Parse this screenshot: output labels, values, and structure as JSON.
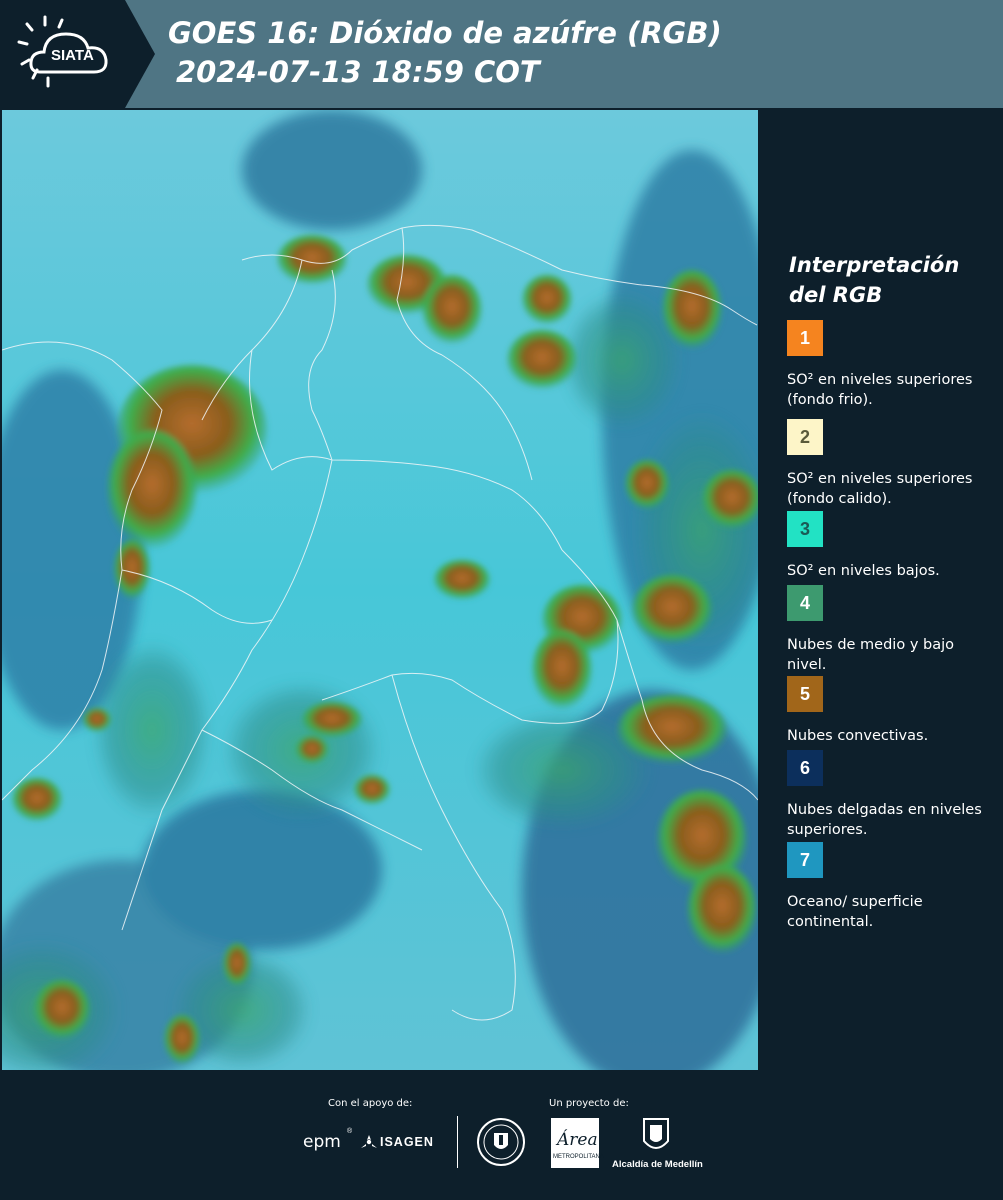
{
  "header": {
    "logo_text": "SIATA",
    "title_line1": "GOES 16: Dióxido de azúfre (RGB)",
    "title_line2": "2024-07-13 18:59 COT"
  },
  "legend": {
    "title": "Interpretación del RGB",
    "items": [
      {
        "number": "1",
        "color": "#f5841f",
        "description": "SO² en niveles superiores (fondo frio)."
      },
      {
        "number": "2",
        "color": "#fdf5c8",
        "description": "SO² en niveles superiores (fondo calido)."
      },
      {
        "number": "3",
        "color": "#22e2c4",
        "description": "SO² en niveles bajos."
      },
      {
        "number": "4",
        "color": "#3d9a6f",
        "description": "Nubes de medio y bajo nivel."
      },
      {
        "number": "5",
        "color": "#a1661a",
        "description": "Nubes convectivas."
      },
      {
        "number": "6",
        "color": "#0c2f5c",
        "description": "Nubes delgadas en niveles superiores."
      },
      {
        "number": "7",
        "color": "#1f97c0",
        "description": "Oceano/ superficie continental."
      }
    ]
  },
  "footer": {
    "support_label": "Con el apoyo de:",
    "project_label": "Un proyecto de:",
    "sponsor_epm": "epm",
    "sponsor_isagen": "ISAGEN",
    "area_logo_text": "Área",
    "area_subtitle": "METROPOLITANA",
    "alcaldia_label": "Alcaldía de Medellín"
  },
  "colors": {
    "header_bg": "#4f7584",
    "panel_bg": "#0d1f2b",
    "map_base": "#58c6d6"
  }
}
